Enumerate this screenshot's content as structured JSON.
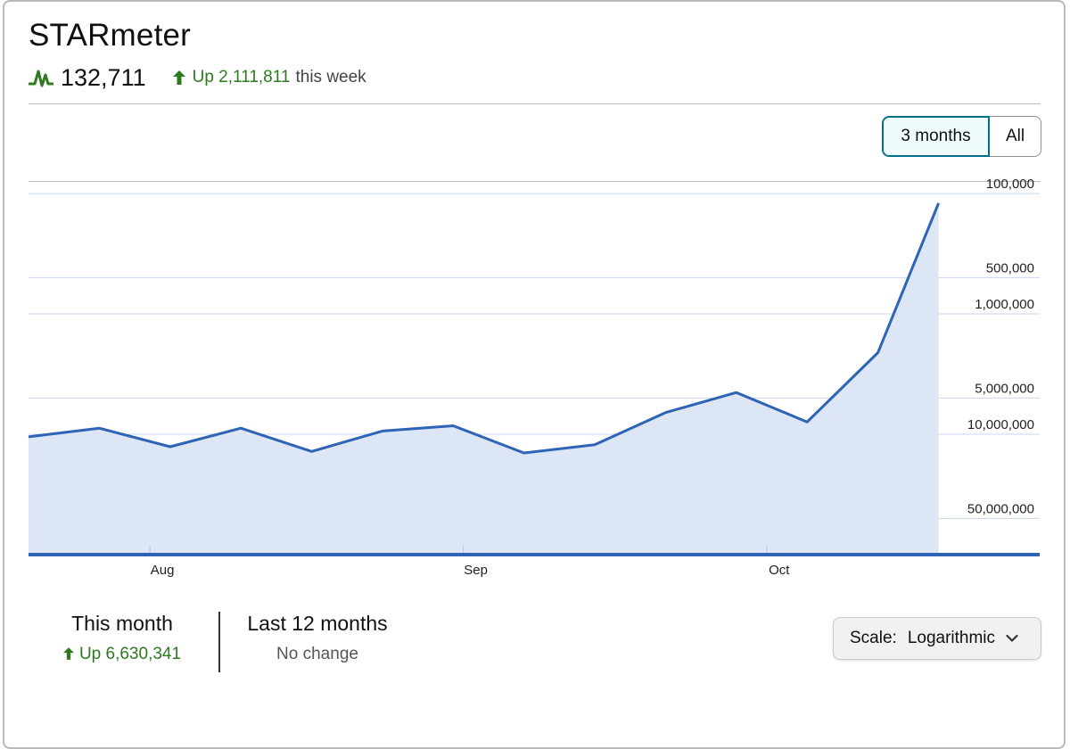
{
  "header": {
    "title": "STARmeter",
    "rank": "132,711",
    "week_change_text": "Up 2,111,811",
    "week_change_suffix": "this week"
  },
  "range_toggle": {
    "options": [
      "3 months",
      "All"
    ],
    "selected": "3 months"
  },
  "chart_data": {
    "type": "area",
    "scale": "logarithmic",
    "y_inverted": true,
    "x_ticks": [
      {
        "label": "Aug",
        "date": "2024-08-01"
      },
      {
        "label": "Sep",
        "date": "2024-09-01"
      },
      {
        "label": "Oct",
        "date": "2024-10-01"
      }
    ],
    "y_ticks": [
      100000,
      500000,
      1000000,
      5000000,
      10000000,
      50000000
    ],
    "y_tick_labels": [
      "100,000",
      "500,000",
      "1,000,000",
      "5,000,000",
      "10,000,000",
      "50,000,000"
    ],
    "ylim": [
      80000,
      100000000
    ],
    "xlim": [
      "2024-07-20",
      "2024-10-28"
    ],
    "grid": true,
    "series": [
      {
        "x": [
          "2024-07-20",
          "2024-07-27",
          "2024-08-03",
          "2024-08-10",
          "2024-08-17",
          "2024-08-24",
          "2024-08-31",
          "2024-09-07",
          "2024-09-14",
          "2024-09-21",
          "2024-09-28",
          "2024-10-05",
          "2024-10-12",
          "2024-10-18"
        ],
        "y": [
          10500000,
          8900000,
          12700000,
          8900000,
          13900000,
          9400000,
          8500000,
          14300000,
          12200000,
          6600000,
          4500000,
          7900000,
          2100000,
          120000
        ]
      }
    ],
    "colors": {
      "line": "#2e63b5",
      "fill": "#dce6f4",
      "baseline": "#2e63b5",
      "grid": "#c9d6ee"
    }
  },
  "stats": {
    "this_month_label": "This month",
    "this_month_value": "Up 6,630,341",
    "last_12_label": "Last 12 months",
    "last_12_value": "No change"
  },
  "scale_select": {
    "label": "Scale:",
    "value": "Logarithmic"
  },
  "colors": {
    "positive": "#2d7a1f",
    "accent": "#007185"
  }
}
